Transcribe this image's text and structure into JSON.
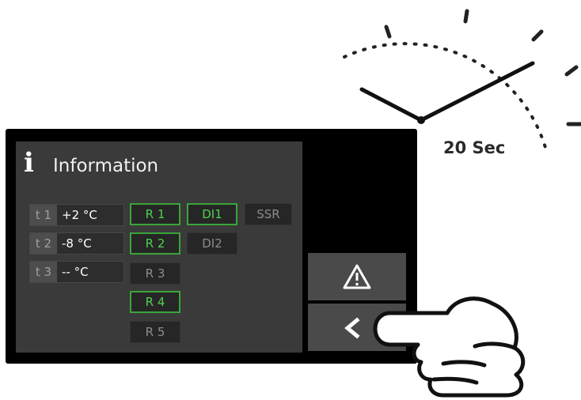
{
  "panel": {
    "title": "Information",
    "info_icon": "i"
  },
  "temperatures": [
    {
      "label": "t 1",
      "value": "+2 °C"
    },
    {
      "label": "t 2",
      "value": "-8 °C"
    },
    {
      "label": "t 3",
      "value": "-- °C"
    }
  ],
  "relays": [
    {
      "label": "R 1",
      "active": true
    },
    {
      "label": "R 2",
      "active": true
    },
    {
      "label": "R 3",
      "active": false
    },
    {
      "label": "R 4",
      "active": true
    },
    {
      "label": "R 5",
      "active": false
    }
  ],
  "digital_inputs": [
    {
      "label": "DI1",
      "active": true
    },
    {
      "label": "DI2",
      "active": false
    }
  ],
  "ssr": {
    "label": "SSR",
    "active": false
  },
  "buttons": {
    "alarm_icon": "warning-icon",
    "back_icon": "chevron-left-icon"
  },
  "timer": {
    "label": "20 Sec"
  },
  "colors": {
    "active_green": "#4fd14f",
    "panel_bg": "#3a3a3a",
    "device_bg": "#000000"
  }
}
